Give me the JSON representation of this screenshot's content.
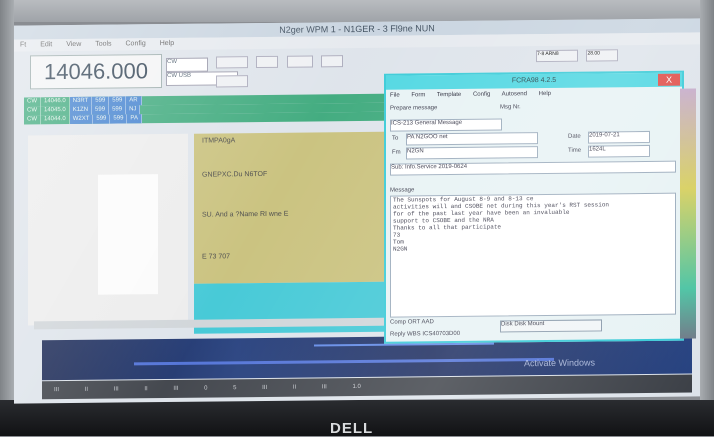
{
  "window": {
    "title": "N2ger WPM 1 - N1GER - 3 Fl9ne NUN"
  },
  "menubar": [
    "Ft",
    "Edit",
    "View",
    "Tools",
    "Config",
    "Help"
  ],
  "frequency": {
    "value": "14046.000",
    "mode": "CW",
    "submode": "CW USB"
  },
  "right_controls": {
    "label": "7-8 ARN8",
    "value": "28.00"
  },
  "log_rows": [
    [
      "CW",
      "14046.0",
      "N3RT",
      "599",
      "599",
      "AR"
    ],
    [
      "CW",
      "14045.0",
      "K1ZN",
      "599",
      "599",
      "NJ"
    ],
    [
      "CW",
      "14044.0",
      "W2XT",
      "599",
      "599",
      "PA"
    ]
  ],
  "yellow_text": {
    "line1": "ITMPA0gA",
    "line2": "GNEPXC.Du N6TOF",
    "line3": "SU. And a ?Name RI wne E",
    "line4": "E 73 707"
  },
  "dialog": {
    "title": "FCRA98 4.2.5",
    "close": "X",
    "menu": [
      "File",
      "Form",
      "Template",
      "Config",
      "Autosend",
      "Help"
    ],
    "toolbar_left": "Prepare message",
    "toolbar_right": "Msg Nr.",
    "section": "ICS-213 General Message",
    "to_label": "To",
    "to_value": "PA N2GOO net",
    "from_label": "Fm",
    "from_value": "N2GN",
    "date_label": "Date",
    "date_value": "2019-07-21",
    "time_label": "Time",
    "time_value": "1624L",
    "subject": "Sub: Info.Service 2019-0624",
    "message_label": "Message",
    "message_lines": [
      "The Sunspots for August 8-9 and 8-13 ce",
      "activities will and CSOBE net during this year's RST session",
      "for of the past last year have been an invaluable",
      "support to CSOBE and the NRA",
      "Thanks to all that participate",
      "73",
      "Tom",
      "N2GN"
    ],
    "comp_label": "Comp",
    "comp_value": "ORT AAD",
    "btn_label": "Disk Disk Mount",
    "reply_label": "Reply",
    "reply_value": "WBS ICS40703D00"
  },
  "screen_watermark": "Activate Windows",
  "bottom_bar": [
    "III",
    "II",
    "III",
    "II",
    "III",
    "0",
    "5",
    "III",
    "II",
    "III",
    "1.0"
  ],
  "brand": "DELL",
  "colors": {
    "grid_green": "#3aa87a",
    "grid_blue": "#3f7fcf",
    "dialog_cyan": "#4bd6e1",
    "close_red": "#e04a45"
  }
}
